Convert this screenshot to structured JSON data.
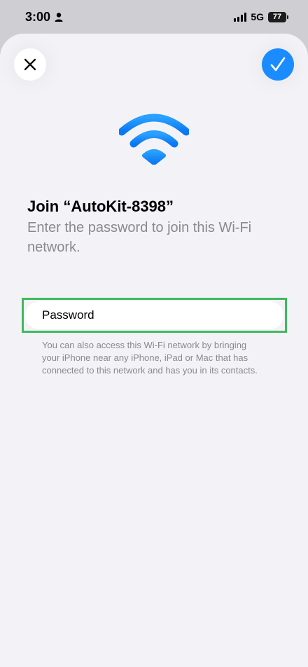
{
  "status_bar": {
    "time": "3:00",
    "network": "5G",
    "battery": "77",
    "icons": [
      "person-icon",
      "signal-icon",
      "battery-icon"
    ]
  },
  "sheet": {
    "close_icon": "close-icon",
    "done_icon": "checkmark-icon",
    "wifi_icon": "wifi-icon",
    "title": "Join “AutoKit-8398”",
    "subtitle": "Enter the password to join this Wi-Fi network.",
    "password": {
      "placeholder": "Password",
      "value": ""
    },
    "note": "You can also access this Wi-Fi network by bringing your iPhone near any iPhone, iPad or Mac that has connected to this network and has you in its contacts."
  },
  "colors": {
    "accent": "#1a8cff",
    "sheet_background": "#f2f2f7",
    "secondary_text": "#8a8a8e",
    "highlight_border": "#3dbb5c"
  }
}
